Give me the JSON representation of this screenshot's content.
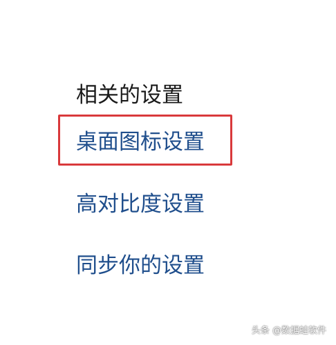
{
  "related_settings": {
    "title": "相关的设置",
    "links": [
      {
        "label": "桌面图标设置",
        "highlighted": true
      },
      {
        "label": "高对比度设置",
        "highlighted": false
      },
      {
        "label": "同步你的设置",
        "highlighted": false
      }
    ]
  },
  "highlight_color": "#d9393b",
  "link_color": "#1f4e8c",
  "watermark": "头条 @数据蛙软件"
}
